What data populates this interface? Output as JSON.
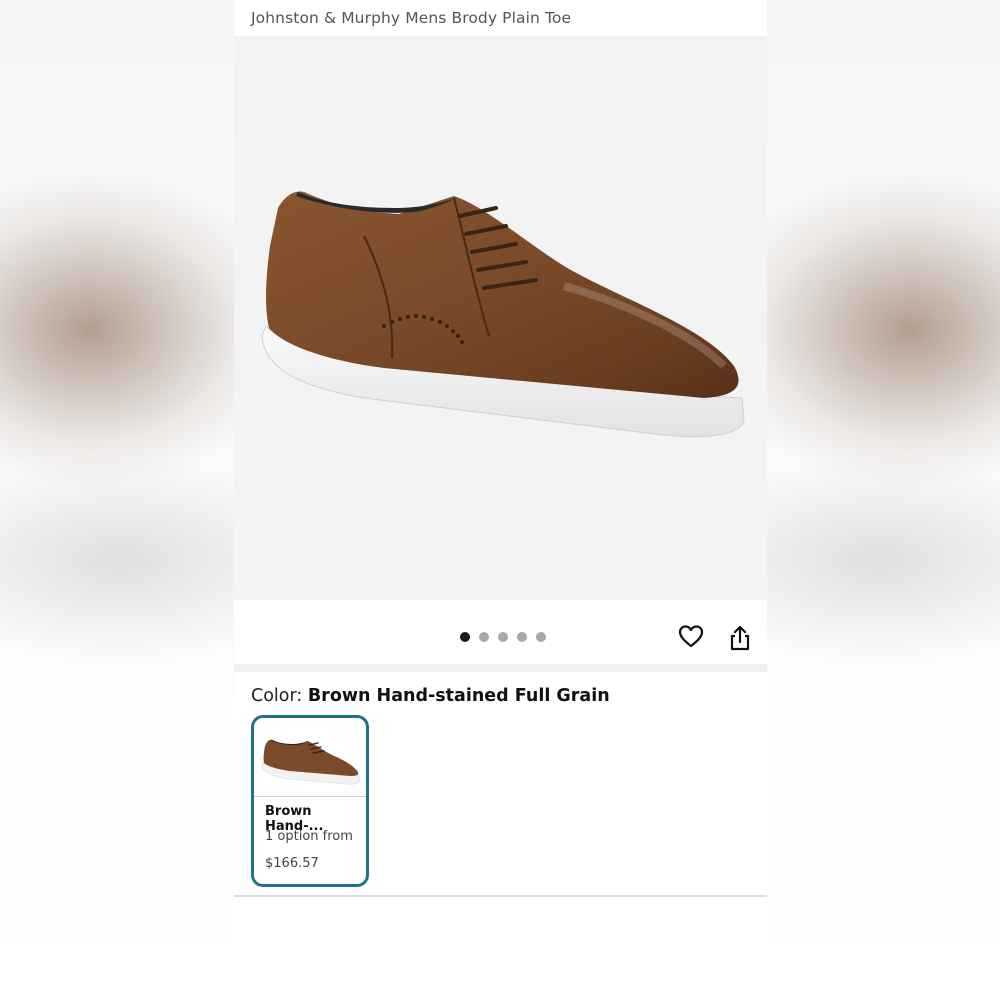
{
  "product": {
    "title": "Johnston & Murphy Mens Brody Plain Toe"
  },
  "gallery": {
    "image": "brown-leather-plain-toe-sneaker-image",
    "pages_total": 5,
    "active_page": 1
  },
  "actions": {
    "favorite_icon": "heart-icon",
    "share_icon": "share-icon"
  },
  "color": {
    "label": "Color: ",
    "value": "Brown Hand-stained Full Grain"
  },
  "swatch": {
    "name": "Brown Hand-...",
    "options": "1 option from",
    "price": "$166.57",
    "border_color": "#1a7686"
  }
}
